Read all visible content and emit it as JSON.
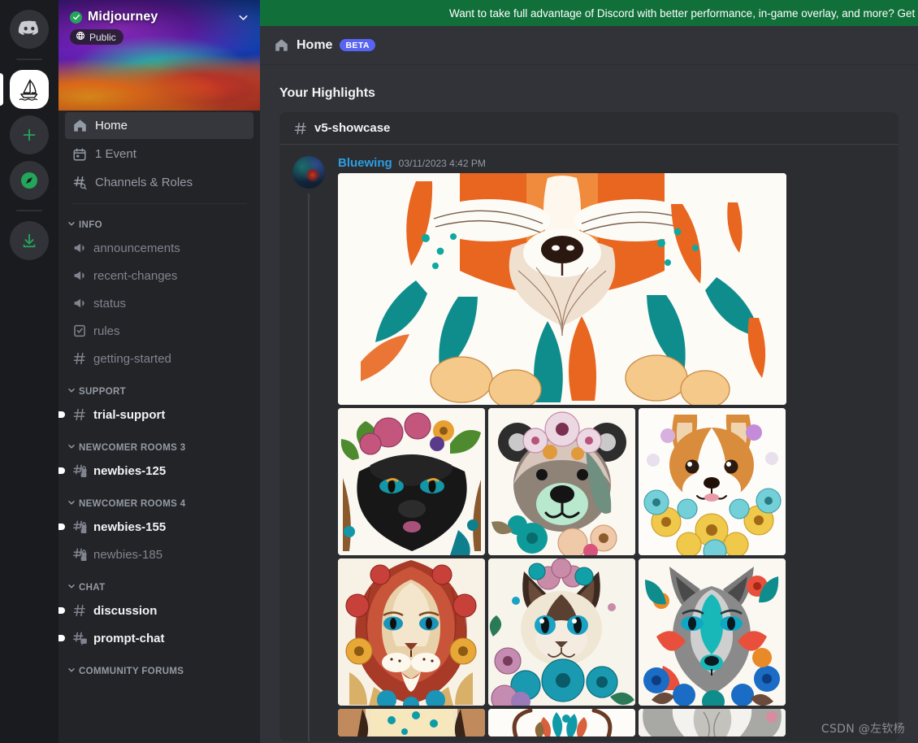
{
  "promo": {
    "text": "Want to take full advantage of Discord with better performance, in-game overlay, and more? Get",
    "bg": "#11703a"
  },
  "rail": {
    "items": [
      {
        "name": "discord-home",
        "label": "Discord",
        "icon": "discord-logo",
        "active": false
      },
      {
        "name": "server-midjourney",
        "label": "Midjourney",
        "icon": "midjourney-sail",
        "active": true
      },
      {
        "name": "add-server",
        "label": "Add a Server",
        "icon": "plus-icon",
        "active": false
      },
      {
        "name": "explore-servers",
        "label": "Explore Discoverable Servers",
        "icon": "compass-icon",
        "active": false
      },
      {
        "name": "download-apps",
        "label": "Download Apps",
        "icon": "download-icon",
        "active": false
      }
    ],
    "accent": "#23a55a"
  },
  "sidebar": {
    "server": {
      "name": "Midjourney",
      "verified": true,
      "privacy_label": "Public",
      "privacy_icon": "globe-icon",
      "chevron": "chevron-down-icon"
    },
    "nav": [
      {
        "label": "Home",
        "icon": "home-icon",
        "active": true
      },
      {
        "label": "1 Event",
        "icon": "calendar-icon",
        "active": false
      },
      {
        "label": "Channels & Roles",
        "icon": "channels-roles-icon",
        "active": false
      }
    ],
    "categories": [
      {
        "label": "INFO",
        "channels": [
          {
            "label": "announcements",
            "icon": "announcement-icon",
            "unread": false
          },
          {
            "label": "recent-changes",
            "icon": "announcement-icon",
            "unread": false
          },
          {
            "label": "status",
            "icon": "announcement-icon",
            "unread": false
          },
          {
            "label": "rules",
            "icon": "rules-icon",
            "unread": false
          },
          {
            "label": "getting-started",
            "icon": "hash-icon",
            "unread": false
          }
        ]
      },
      {
        "label": "SUPPORT",
        "channels": [
          {
            "label": "trial-support",
            "icon": "hash-icon",
            "unread": true
          }
        ]
      },
      {
        "label": "NEWCOMER ROOMS 3",
        "channels": [
          {
            "label": "newbies-125",
            "icon": "hash-lock-icon",
            "unread": true
          }
        ]
      },
      {
        "label": "NEWCOMER ROOMS 4",
        "channels": [
          {
            "label": "newbies-155",
            "icon": "hash-lock-icon",
            "unread": true
          },
          {
            "label": "newbies-185",
            "icon": "hash-lock-icon",
            "unread": false
          }
        ]
      },
      {
        "label": "CHAT",
        "channels": [
          {
            "label": "discussion",
            "icon": "hash-icon",
            "unread": true
          },
          {
            "label": "prompt-chat",
            "icon": "hash-thread-icon",
            "unread": true
          }
        ]
      },
      {
        "label": "COMMUNITY FORUMS",
        "channels": []
      }
    ]
  },
  "main": {
    "title": "Home",
    "title_icon": "home-icon",
    "badge": "BETA",
    "badge_color": "#5865f2",
    "highlights_heading": "Your Highlights",
    "highlight_card": {
      "channel": "v5-showcase",
      "channel_icon": "hash-icon",
      "message": {
        "author": "Bluewing",
        "author_color": "#2d9ee0",
        "timestamp": "03/11/2023 4:42 PM",
        "attachments": [
          {
            "name": "fox-floral-hero",
            "layout": "hero"
          },
          {
            "name": "black-panther-floral",
            "layout": "grid"
          },
          {
            "name": "bear-floral",
            "layout": "grid"
          },
          {
            "name": "corgi-floral",
            "layout": "grid"
          },
          {
            "name": "lion-floral",
            "layout": "grid"
          },
          {
            "name": "siamese-cat-floral",
            "layout": "grid"
          },
          {
            "name": "wolf-floral",
            "layout": "grid"
          },
          {
            "name": "cream-animal-floral",
            "layout": "grid-clipped"
          },
          {
            "name": "deer-antlers-floral",
            "layout": "grid-clipped"
          },
          {
            "name": "elephant-floral",
            "layout": "grid-clipped"
          }
        ]
      }
    }
  },
  "watermark": "CSDN @左钦杨"
}
